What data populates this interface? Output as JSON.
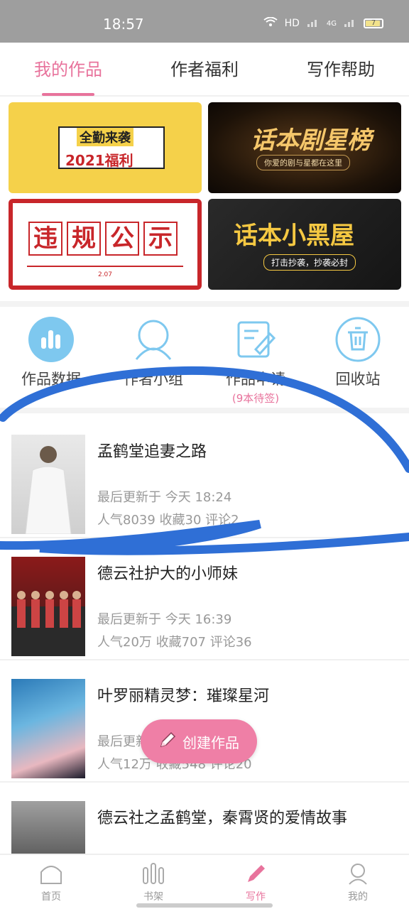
{
  "status": {
    "time": "18:57",
    "network": "HD",
    "signal": "4G",
    "battery": "7"
  },
  "tabs": [
    "我的作品",
    "作者福利",
    "写作帮助"
  ],
  "banners": {
    "b1": {
      "line1": "全勤来袭",
      "line2": "2021福利"
    },
    "b2": {
      "title": "话本剧星榜",
      "subtitle": "你爱的剧与星都在这里"
    },
    "b3": {
      "chars": [
        "违",
        "规",
        "公",
        "示"
      ],
      "date": "2.07"
    },
    "b4": {
      "title": "话本小黑屋",
      "subtitle": "打击抄袭，抄袭必封"
    }
  },
  "actions": [
    {
      "label": "作品数据",
      "icon": "bar-chart-icon"
    },
    {
      "label": "作者小组",
      "icon": "group-icon"
    },
    {
      "label": "作品申请",
      "icon": "edit-document-icon",
      "sub": "(9本待签)"
    },
    {
      "label": "回收站",
      "icon": "trash-icon"
    }
  ],
  "works": [
    {
      "title": "孟鹤堂追妻之路",
      "updated": "最后更新于 今天 18:24",
      "stats": "人气8039 收藏30 评论2"
    },
    {
      "title": "德云社护大的小师妹",
      "updated": "最后更新于 今天 16:39",
      "stats": "人气20万 收藏707 评论36"
    },
    {
      "title": "叶罗丽精灵梦：璀璨星河",
      "updated": "最后更新于 今天 15:11",
      "stats": "人气12万 收藏548 评论20"
    },
    {
      "title": "德云社之孟鹤堂，秦霄贤的爱情故事",
      "updated": "",
      "stats": ""
    }
  ],
  "fab": {
    "label": "创建作品"
  },
  "nav": [
    "首页",
    "书架",
    "写作",
    "我的"
  ],
  "colors": {
    "accent": "#e8739c",
    "icon_blue": "#7ec8ef",
    "scribble": "#2f6fd6"
  }
}
